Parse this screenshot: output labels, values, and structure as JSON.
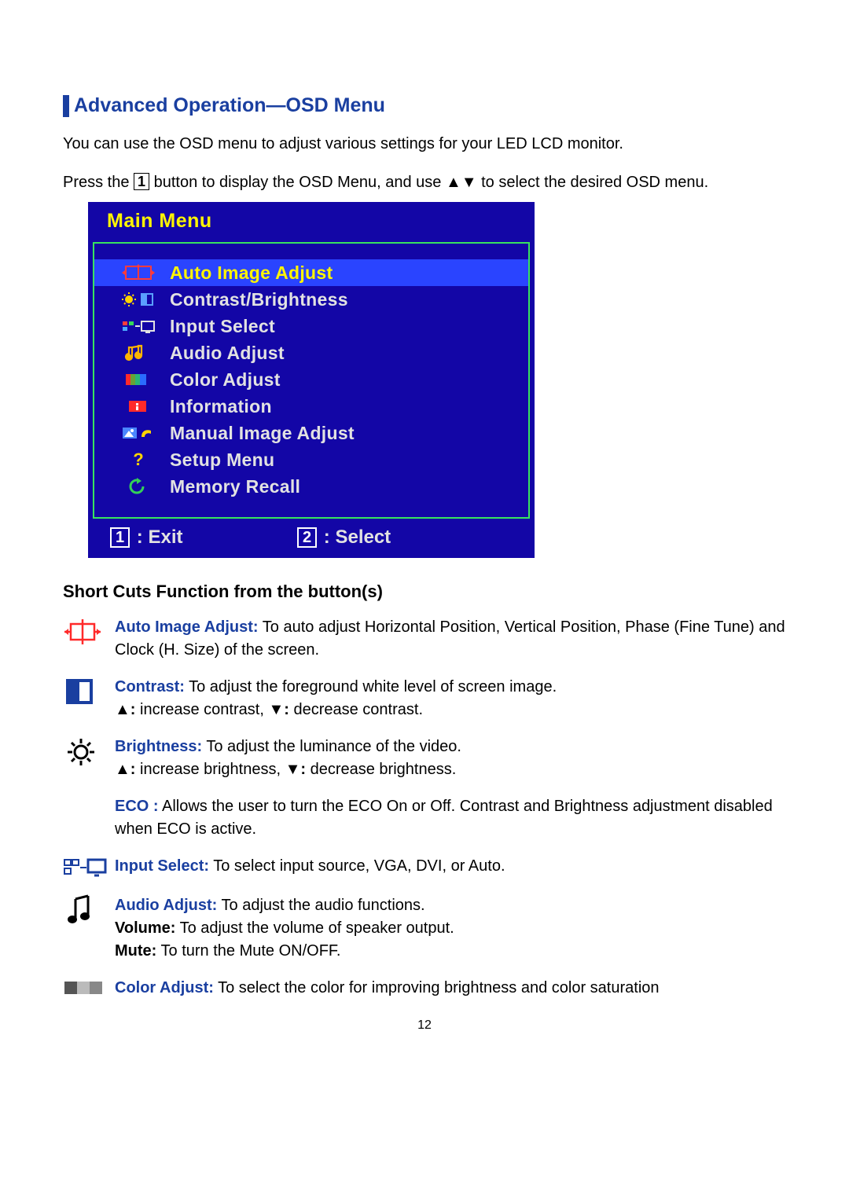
{
  "section_title": "Advanced Operation—OSD Menu",
  "intro_1a": "You can use the OSD menu to adjust various settings for your ",
  "intro_1b": "LED LCD monitor",
  "intro_1c": ".",
  "intro_2a": "Press the ",
  "intro_2_key": "1",
  "intro_2b": " button to display the OSD Menu, and use ▲▼ to select the desired OSD menu.",
  "osd": {
    "title": "Main Menu",
    "items": [
      {
        "label": "Auto Image Adjust"
      },
      {
        "label": "Contrast/Brightness"
      },
      {
        "label": "Input Select"
      },
      {
        "label": "Audio Adjust"
      },
      {
        "label": "Color Adjust"
      },
      {
        "label": "Information"
      },
      {
        "label": "Manual Image Adjust"
      },
      {
        "label": "Setup Menu"
      },
      {
        "label": "Memory Recall"
      }
    ],
    "footer": {
      "key1": "1",
      "label1": ": Exit",
      "key2": "2",
      "label2": ": Select"
    }
  },
  "shortcuts_title": "Short Cuts Function from the button(s)",
  "sc": {
    "auto_term": "Auto Image Adjust:",
    "auto_desc": " To auto adjust Horizontal Position, Vertical Position, Phase (Fine Tune) and Clock (H. Size) of the screen.",
    "contrast_term": "Contrast:",
    "contrast_desc": " To adjust the foreground white level of screen image.",
    "contrast_up_k": "▲:",
    "contrast_up": " increase contrast, ",
    "contrast_dn_k": "▼:",
    "contrast_dn": " decrease contrast.",
    "bright_term": "Brightness:",
    "bright_desc": " To adjust the luminance of the video.",
    "bright_up_k": "▲:",
    "bright_up": " increase brightness, ",
    "bright_dn_k": "▼:",
    "bright_dn": " decrease brightness.",
    "eco_term": "ECO :",
    "eco_desc": " Allows the user to turn the ECO On or Off. Contrast and Brightness adjustment disabled when ECO is active.",
    "input_term": "Input Select:",
    "input_desc": "  To select input source, VGA, DVI, or Auto.",
    "audio_term": "Audio Adjust:",
    "audio_desc": " To adjust the audio functions.",
    "audio_vol_k": "Volume:",
    "audio_vol": " To adjust the volume of speaker output.",
    "audio_mute_k": "Mute:",
    "audio_mute": " To turn the Mute ON/OFF.",
    "color_term": "Color Adjust:",
    "color_desc": " To select the color for improving brightness and color saturation"
  },
  "page_number": "12"
}
